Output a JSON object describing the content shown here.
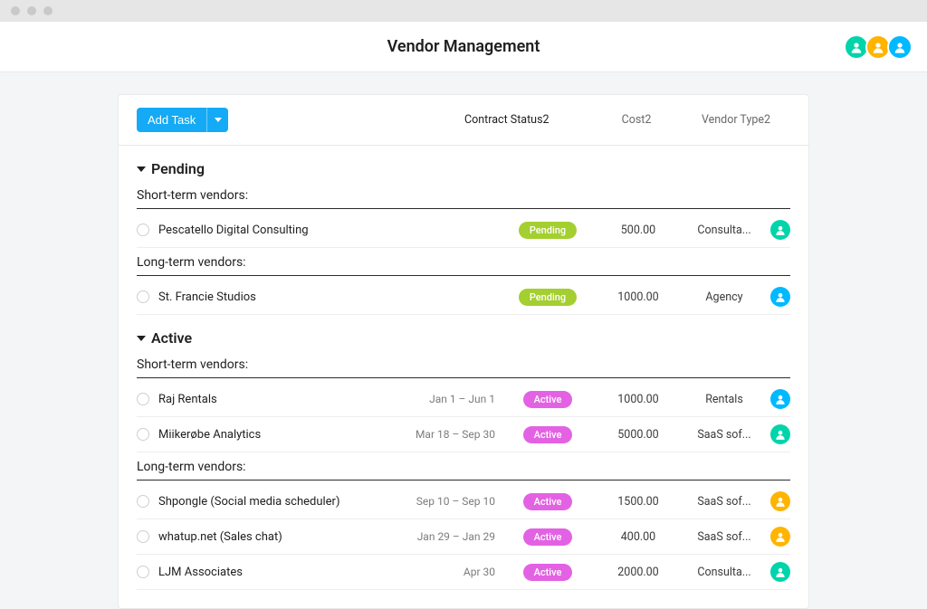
{
  "header": {
    "title": "Vendor Management"
  },
  "toolbar": {
    "add_task_label": "Add Task",
    "columns": {
      "status": "Contract Status2",
      "cost": "Cost2",
      "vendor_type": "Vendor Type2"
    }
  },
  "sections": [
    {
      "title": "Pending",
      "groups": [
        {
          "heading": "Short-term vendors:",
          "rows": [
            {
              "name": "Pescatello Digital Consulting",
              "dates": "",
              "status": "Pending",
              "status_kind": "pending",
              "cost": "500.00",
              "vendor_type": "Consulta...",
              "avatar_color": "a1"
            }
          ]
        },
        {
          "heading": "Long-term vendors:",
          "rows": [
            {
              "name": "St. Francie Studios",
              "dates": "",
              "status": "Pending",
              "status_kind": "pending",
              "cost": "1000.00",
              "vendor_type": "Agency",
              "avatar_color": "a3"
            }
          ]
        }
      ]
    },
    {
      "title": "Active",
      "groups": [
        {
          "heading": "Short-term vendors:",
          "rows": [
            {
              "name": "Raj Rentals",
              "dates": "Jan 1 – Jun 1",
              "status": "Active",
              "status_kind": "active",
              "cost": "1000.00",
              "vendor_type": "Rentals",
              "avatar_color": "a3"
            },
            {
              "name": "Miikerøbe Analytics",
              "dates": "Mar 18 – Sep 30",
              "status": "Active",
              "status_kind": "active",
              "cost": "5000.00",
              "vendor_type": "SaaS sof...",
              "avatar_color": "a1"
            }
          ]
        },
        {
          "heading": "Long-term vendors:",
          "rows": [
            {
              "name": "Shpongle (Social media scheduler)",
              "dates": "Sep 10 – Sep 10",
              "status": "Active",
              "status_kind": "active",
              "cost": "1500.00",
              "vendor_type": "SaaS sof...",
              "avatar_color": "a2"
            },
            {
              "name": "whatup.net (Sales chat)",
              "dates": "Jan 29 – Jan 29",
              "status": "Active",
              "status_kind": "active",
              "cost": "400.00",
              "vendor_type": "SaaS sof...",
              "avatar_color": "a2"
            },
            {
              "name": "LJM Associates",
              "dates": "Apr 30",
              "status": "Active",
              "status_kind": "active",
              "cost": "2000.00",
              "vendor_type": "Consulta...",
              "avatar_color": "a1"
            }
          ]
        }
      ]
    }
  ]
}
